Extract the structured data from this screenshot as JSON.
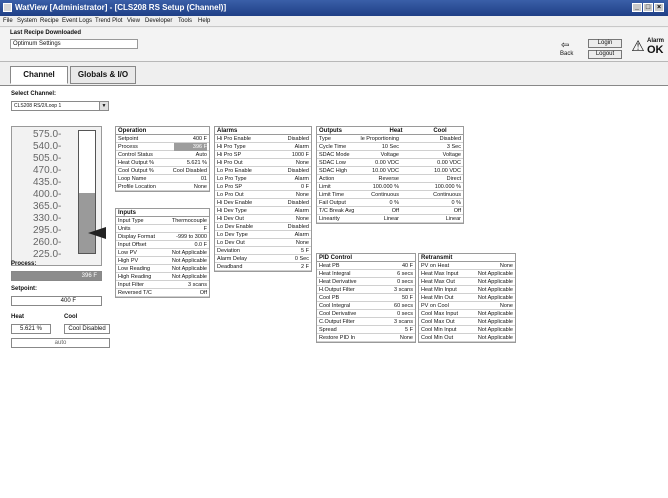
{
  "window": {
    "title": "WatView [Administrator] - [CLS208 RS Setup (Channel)]"
  },
  "menu": [
    "File",
    "System",
    "Recipe",
    "Event Logs",
    "Trend Plot",
    "View",
    "Developer",
    "Tools",
    "Help"
  ],
  "recipe": {
    "label": "Last Recipe Downloaded",
    "value": "Optimum Settings"
  },
  "toolbar": {
    "back_label": "Back",
    "login_label": "Login",
    "logout_label": "Logout",
    "alarm_label": "Alarm",
    "alarm_status": "OK"
  },
  "tabs": [
    "Channel",
    "Globals & I/O"
  ],
  "channel_select": {
    "label": "Select Channel:",
    "value": "CLS208 RS/2/Loop 1"
  },
  "gauge": {
    "ticks": [
      "575.0-",
      "540.0-",
      "505.0-",
      "470.0-",
      "435.0-",
      "400.0-",
      "365.0-",
      "330.0-",
      "295.0-",
      "260.0-",
      "225.0-"
    ],
    "range": [
      225,
      575
    ],
    "value": 396
  },
  "process": {
    "label": "Process:",
    "value": "396 F"
  },
  "setpoint": {
    "label": "Setpoint:",
    "value": "400 F"
  },
  "heat": {
    "label": "Heat",
    "value": "5.621 %"
  },
  "cool": {
    "label": "Cool",
    "value": "Cool Disabled"
  },
  "mode": {
    "value": "auto"
  },
  "operation": {
    "title": "Operation",
    "rows": [
      {
        "k": "Setpoint",
        "v": "400 F"
      },
      {
        "k": "Process",
        "v": "396 F"
      },
      {
        "k": "Control Status",
        "v": "Auto"
      },
      {
        "k": "Heat Output %",
        "v": "5.621 %"
      },
      {
        "k": "Cool Output %",
        "v": "Cool Disabled"
      },
      {
        "k": "Loop Name",
        "v": "01"
      },
      {
        "k": "Profile Location",
        "v": "None"
      }
    ]
  },
  "inputs": {
    "title": "Inputs",
    "rows": [
      {
        "k": "Input Type",
        "v": "Thermocouple"
      },
      {
        "k": "Units",
        "v": "F"
      },
      {
        "k": "Display Format",
        "v": "-999 to 3000"
      },
      {
        "k": "Input Offset",
        "v": "0.0 F"
      },
      {
        "k": "Low PV",
        "v": "Not Applicable"
      },
      {
        "k": "High PV",
        "v": "Not Applicable"
      },
      {
        "k": "Low Reading",
        "v": "Not Applicable"
      },
      {
        "k": "High Reading",
        "v": "Not Applicable"
      },
      {
        "k": "Input Filter",
        "v": "3 scans"
      },
      {
        "k": "Reversed T/C",
        "v": "Off"
      }
    ]
  },
  "alarms": {
    "title": "Alarms",
    "rows": [
      {
        "k": "Hi Pro Enable",
        "v": "Disabled"
      },
      {
        "k": "Hi Pro Type",
        "v": "Alarm"
      },
      {
        "k": "Hi Pro SP",
        "v": "1000 F"
      },
      {
        "k": "Hi Pro Out",
        "v": "None"
      },
      {
        "k": "Lo Pro Enable",
        "v": "Disabled"
      },
      {
        "k": "Lo Pro Type",
        "v": "Alarm"
      },
      {
        "k": "Lo Pro SP",
        "v": "0 F"
      },
      {
        "k": "Lo Pro Out",
        "v": "None"
      },
      {
        "k": "Hi Dev Enable",
        "v": "Disabled"
      },
      {
        "k": "Hi Dev Type",
        "v": "Alarm"
      },
      {
        "k": "Hi Dev Out",
        "v": "None"
      },
      {
        "k": "Lo Dev Enable",
        "v": "Disabled"
      },
      {
        "k": "Lo Dev Type",
        "v": "Alarm"
      },
      {
        "k": "Lo Dev Out",
        "v": "None"
      },
      {
        "k": "Deviation",
        "v": "5 F"
      },
      {
        "k": "Alarm Delay",
        "v": "0 Sec"
      },
      {
        "k": "Deadband",
        "v": "2 F"
      }
    ]
  },
  "outputs": {
    "title": "Outputs",
    "col_heat": "Heat",
    "col_cool": "Cool",
    "rows": [
      {
        "k": "Type",
        "heat": "le Proportioning",
        "cool": "Disabled"
      },
      {
        "k": "Cycle Time",
        "heat": "10 Sec",
        "cool": "3 Sec"
      },
      {
        "k": "SDAC Mode",
        "heat": "Voltage",
        "cool": "Voltage"
      },
      {
        "k": "SDAC Low",
        "heat": "0.00 VDC",
        "cool": "0.00 VDC"
      },
      {
        "k": "SDAC High",
        "heat": "10.00 VDC",
        "cool": "10.00 VDC"
      },
      {
        "k": "Action",
        "heat": "Reverse",
        "cool": "Direct"
      },
      {
        "k": "Limit",
        "heat": "100.000 %",
        "cool": "100.000 %"
      },
      {
        "k": "Limit Time",
        "heat": "Continuous",
        "cool": "Continuous"
      },
      {
        "k": "Fail Output",
        "heat": "0 %",
        "cool": "0 %"
      },
      {
        "k": "T/C Break Avg",
        "heat": "Off",
        "cool": "Off"
      },
      {
        "k": "Linearity",
        "heat": "Linear",
        "cool": "Linear"
      }
    ]
  },
  "pid": {
    "title": "PID Control",
    "rows": [
      {
        "k": "Heat PB",
        "v": "40 F"
      },
      {
        "k": "Heat Integral",
        "v": "6 secs"
      },
      {
        "k": "Heat Derivative",
        "v": "0 secs"
      },
      {
        "k": "H.Output Filter",
        "v": "3 scans"
      },
      {
        "k": "Cool PB",
        "v": "50 F"
      },
      {
        "k": "Cool Integral",
        "v": "60 secs"
      },
      {
        "k": "Cool Derivative",
        "v": "0 secs"
      },
      {
        "k": "C.Output Filter",
        "v": "3 scans"
      },
      {
        "k": "Spread",
        "v": "5 F"
      },
      {
        "k": "Restore PID In",
        "v": "None"
      }
    ]
  },
  "retransmit": {
    "title": "Retransmit",
    "rows": [
      {
        "k": "PV on Heat",
        "v": "None"
      },
      {
        "k": "Heat Max Input",
        "v": "Not Applicable"
      },
      {
        "k": "Heat Max Out",
        "v": "Not Applicable"
      },
      {
        "k": "Heat Min Input",
        "v": "Not Applicable"
      },
      {
        "k": "Heat Min Out",
        "v": "Not Applicable"
      },
      {
        "k": "PV on Cool",
        "v": "None"
      },
      {
        "k": "Cool Max Input",
        "v": "Not Applicable"
      },
      {
        "k": "Cool Max Out",
        "v": "Not Applicable"
      },
      {
        "k": "Cool Min Input",
        "v": "Not Applicable"
      },
      {
        "k": "Cool Min Out",
        "v": "Not Applicable"
      }
    ]
  }
}
